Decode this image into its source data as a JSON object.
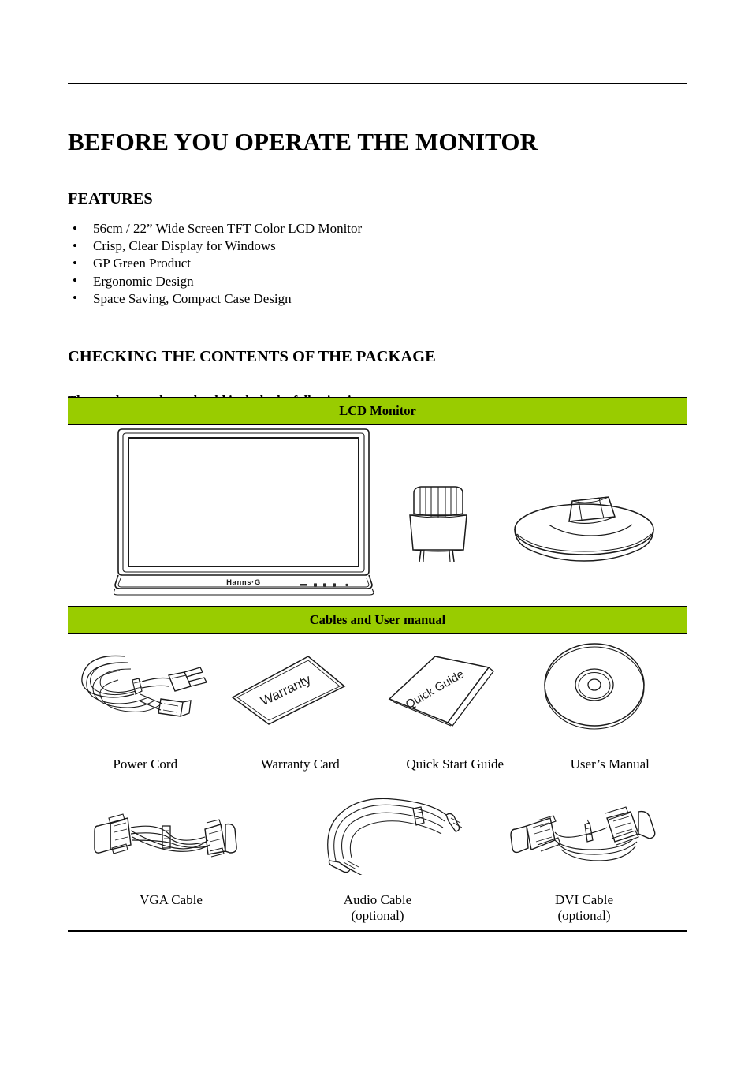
{
  "document": {
    "title": "BEFORE YOU OPERATE THE MONITOR"
  },
  "features": {
    "heading": "FEATURES",
    "bullet_glyph": "•",
    "items": [
      "56cm / 22” Wide Screen TFT Color LCD Monitor",
      "Crisp, Clear Display for Windows",
      "GP Green Product",
      "Ergonomic Design",
      "Space Saving, Compact Case Design"
    ]
  },
  "package": {
    "heading": "CHECKING THE CONTENTS OF THE PACKAGE",
    "lead": "The product package should include the following items:",
    "band_color": "#99cc00",
    "sections": [
      {
        "band_label": "LCD Monitor"
      },
      {
        "band_label": "Cables and User manual"
      }
    ],
    "monitor_brand": "Hanns·G",
    "accessories_row_1": [
      {
        "label": "Power Cord",
        "sub": "",
        "icon": "power-cord-illustration"
      },
      {
        "label": "Warranty Card",
        "sub": "",
        "icon": "warranty-card-illustration",
        "card_text": "Warranty"
      },
      {
        "label": "Quick Start Guide",
        "sub": "",
        "icon": "quick-guide-illustration",
        "card_text": "Quick Guide"
      },
      {
        "label": "User’s Manual",
        "sub": "",
        "icon": "cd-disc-illustration"
      }
    ],
    "accessories_row_2": [
      {
        "label": "VGA Cable",
        "sub": "",
        "icon": "vga-cable-illustration"
      },
      {
        "label": "Audio Cable",
        "sub": "(optional)",
        "icon": "audio-cable-illustration"
      },
      {
        "label": "DVI Cable",
        "sub": "(optional)",
        "icon": "dvi-cable-illustration"
      }
    ]
  }
}
